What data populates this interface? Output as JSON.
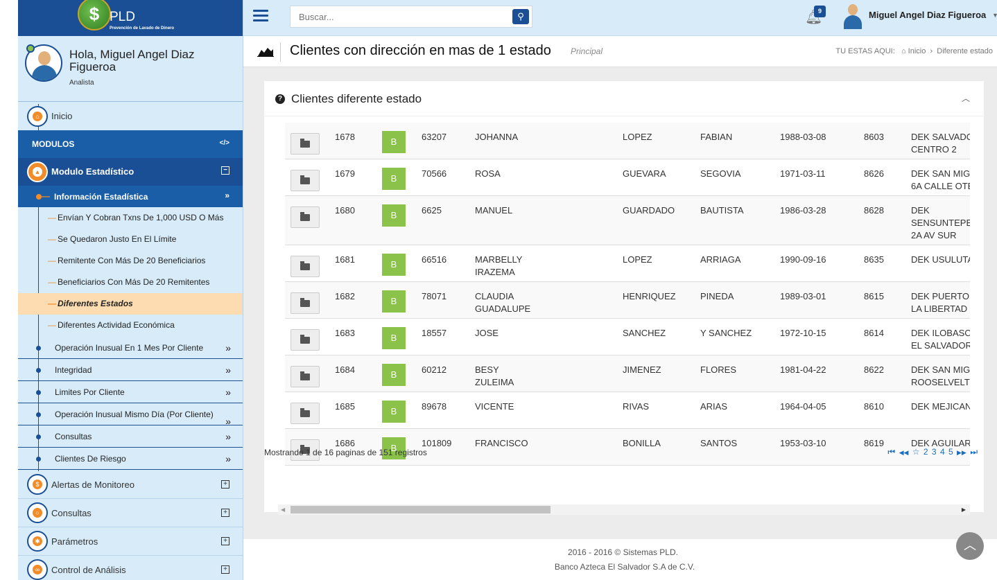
{
  "brand": {
    "title": "PLD",
    "subtitle": "Prevención de Lavado de Dinero",
    "logo_symbol": "$"
  },
  "profile": {
    "greeting": "Hola, Miguel Angel Diaz Figueroa",
    "role": "Analista"
  },
  "sidebar": {
    "inicio": "Inicio",
    "modulos_header": "MODULOS",
    "modulos_icon": "</>",
    "modulo_estadistico": "Modulo Estadístico",
    "info_estadistica": "Información Estadística",
    "sublinks": [
      "Envían Y Cobran Txns De 1,000 USD O Más",
      "Se Quedaron Justo En El Límite",
      "Remitente Con Más De 20 Beneficiarios",
      "Beneficiarios Con Más De 20 Remitentes",
      "Diferentes Estados",
      "Diferentes Actividad Económica"
    ],
    "groups": [
      "Operación Inusual En 1 Mes Por Cliente",
      "Integridad",
      "Limites Por Cliente",
      "Operación Inusual Mismo Día (Por Cliente)",
      "Consultas",
      "Clientes De Riesgo"
    ],
    "sections": [
      "Alertas de Monitoreo",
      "Consultas",
      "Parámetros",
      "Control de Análisis"
    ]
  },
  "topbar": {
    "search_placeholder": "Buscar...",
    "notifications": "9",
    "user_name": "Miguel Angel Diaz Figueroa"
  },
  "page": {
    "title": "Clientes con dirección en mas de 1 estado",
    "subtitle": "Principal",
    "breadcrumb_label": "TU ESTAS AQUI:",
    "breadcrumb_home": "Inicio",
    "breadcrumb_sep": "›",
    "breadcrumb_current": "Diferente estado"
  },
  "panel": {
    "title": "Clientes diferente estado"
  },
  "table": {
    "rows": [
      {
        "id": "1678",
        "status": "B",
        "code": "63207",
        "name1": "JOHANNA",
        "name2": "",
        "last1": "LOPEZ",
        "last2": "FABIAN",
        "dob": "1988-03-08",
        "branch": "8603",
        "addr1": "DEK SALVADO",
        "addr2": "CENTRO 2",
        "addr3": ""
      },
      {
        "id": "1679",
        "status": "B",
        "code": "70566",
        "name1": "ROSA",
        "name2": "",
        "last1": "GUEVARA",
        "last2": "SEGOVIA",
        "dob": "1971-03-11",
        "branch": "8626",
        "addr1": "DEK SAN MIG",
        "addr2": "6A CALLE OTE",
        "addr3": ""
      },
      {
        "id": "1680",
        "status": "B",
        "code": "6625",
        "name1": "MANUEL",
        "name2": "",
        "last1": "GUARDADO",
        "last2": "BAUTISTA",
        "dob": "1986-03-28",
        "branch": "8628",
        "addr1": "DEK",
        "addr2": "SENSUNTEPE",
        "addr3": "2A AV SUR"
      },
      {
        "id": "1681",
        "status": "B",
        "code": "66516",
        "name1": "MARBELLY",
        "name2": "IRAZEMA",
        "last1": "LOPEZ",
        "last2": "ARRIAGA",
        "dob": "1990-09-16",
        "branch": "8635",
        "addr1": "DEK USULUTA",
        "addr2": "",
        "addr3": ""
      },
      {
        "id": "1682",
        "status": "B",
        "code": "78071",
        "name1": "CLAUDIA",
        "name2": "GUADALUPE",
        "last1": "HENRIQUEZ",
        "last2": "PINEDA",
        "dob": "1989-03-01",
        "branch": "8615",
        "addr1": "DEK PUERTO",
        "addr2": "LA LIBERTAD",
        "addr3": ""
      },
      {
        "id": "1683",
        "status": "B",
        "code": "18557",
        "name1": "JOSE",
        "name2": "",
        "last1": "SANCHEZ",
        "last2": "Y SANCHEZ",
        "dob": "1972-10-15",
        "branch": "8614",
        "addr1": "DEK ILOBASC",
        "addr2": "EL SALVADOR",
        "addr3": ""
      },
      {
        "id": "1684",
        "status": "B",
        "code": "60212",
        "name1": "BESY",
        "name2": "ZULEIMA",
        "last1": "JIMENEZ",
        "last2": "FLORES",
        "dob": "1981-04-22",
        "branch": "8622",
        "addr1": "DEK SAN MIG",
        "addr2": "ROOSELVELT",
        "addr3": ""
      },
      {
        "id": "1685",
        "status": "B",
        "code": "89678",
        "name1": "VICENTE",
        "name2": "",
        "last1": "RIVAS",
        "last2": "ARIAS",
        "dob": "1964-04-05",
        "branch": "8610",
        "addr1": "DEK MEJICAN",
        "addr2": "",
        "addr3": ""
      },
      {
        "id": "1686",
        "status": "B",
        "code": "101809",
        "name1": "FRANCISCO",
        "name2": "",
        "last1": "BONILLA",
        "last2": "SANTOS",
        "dob": "1953-03-10",
        "branch": "8619",
        "addr1": "DEK AGUILAR",
        "addr2": "",
        "addr3": ""
      }
    ]
  },
  "pagination": {
    "info": "Mostrando 1 de 16 paginas de 151 registros",
    "first": "⏮",
    "prev": "◀◀",
    "current": "☆",
    "pages": [
      "2",
      "3",
      "4",
      "5"
    ],
    "next": "▶▶",
    "last": "⏭"
  },
  "footer": {
    "line1": "2016 - 2016 © Sistemas PLD.",
    "line2": "Banco Azteca El Salvador S.A de C.V."
  },
  "colors": {
    "primary": "#1a4f95",
    "sidebar_bg": "#d7ebf8",
    "accent": "#f28c28",
    "status_green": "#8bc34a",
    "active_highlight": "#fcdcb0"
  }
}
